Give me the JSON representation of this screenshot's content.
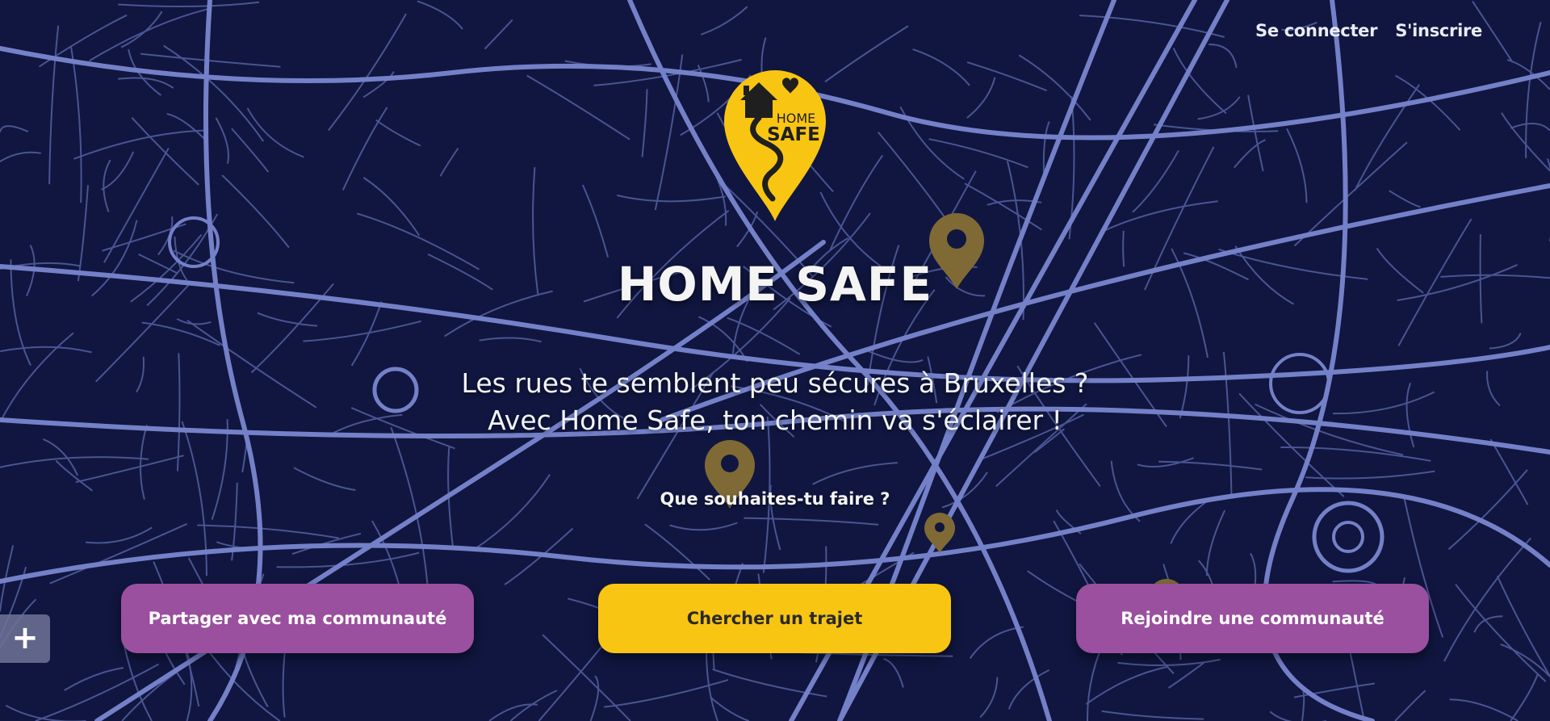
{
  "nav": {
    "login": "Se connecter",
    "signup": "S'inscrire"
  },
  "logo": {
    "line1": "HOME",
    "line2": "SAFE"
  },
  "hero": {
    "title": "HOME SAFE",
    "tagline_line1": "Les rues te semblent peu sécures à Bruxelles ?",
    "tagline_line2": "Avec Home Safe, ton chemin va s'éclairer !",
    "question": "Que souhaites-tu faire ?"
  },
  "actions": {
    "share": "Partager avec ma communauté",
    "search": "Chercher un trajet",
    "join": "Rejoindre une communauté"
  },
  "map": {
    "zoom_in": "+"
  },
  "colors": {
    "background": "#10163f",
    "streets": "#6f7cc3",
    "accent_yellow": "#f9c513",
    "accent_purple": "#9a4f9f",
    "map_pin": "#7f6a35"
  },
  "icons": {
    "logo": "location-pin-house-heart-icon",
    "map_markers": "map-pin-icon",
    "zoom": "plus-icon"
  }
}
